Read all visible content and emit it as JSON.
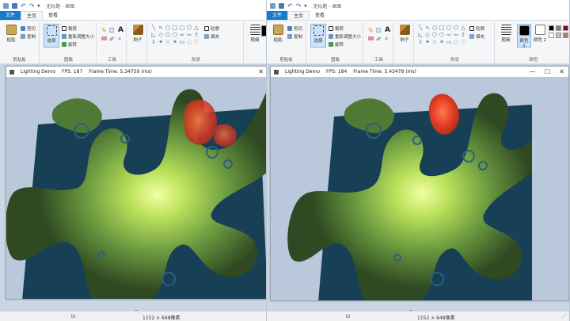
{
  "paint": {
    "title": "无标题 - 画图",
    "tabs": [
      "文件",
      "主页",
      "查看"
    ],
    "groups": {
      "clipboard": "剪贴板",
      "image": "图像",
      "tools": "工具",
      "shapes": "形状",
      "colors": "颜色"
    },
    "buttons": {
      "paste": "粘贴",
      "cut": "剪切",
      "copy": "复制",
      "select": "选择",
      "crop": "裁剪",
      "resize": "重新调整大小",
      "rotate": "旋转",
      "brush": "刷子",
      "outline": "轮廓",
      "fill": "填充",
      "size": "粗细",
      "color1": "颜色 1",
      "color2": "颜色 2"
    },
    "status": {
      "image_size": "1152 × 648像素"
    }
  },
  "demo_left": {
    "title": "Lighting Demo",
    "fps": "FPS: 187",
    "frame_time": "Frame Time: 5.34759 (ms)"
  },
  "demo_right": {
    "title": "Lighting Demo",
    "fps": "FPS: 184",
    "frame_time": "Frame Time: 5.43478 (ms)"
  },
  "window_controls": {
    "minimize": "—",
    "maximize": "☐",
    "close": "✕"
  },
  "icons": {
    "save": "save-icon",
    "undo": "undo-icon",
    "redo": "redo-icon",
    "size_grip": "resize-grip-icon"
  },
  "colors": {
    "file_tab": "#1979ca",
    "canvas_bg": "#cbd6e5",
    "terrain_green": "#5f8f3f",
    "water": "#173f55",
    "light_glow": "#eaff84",
    "red_light": "#e4472a"
  }
}
